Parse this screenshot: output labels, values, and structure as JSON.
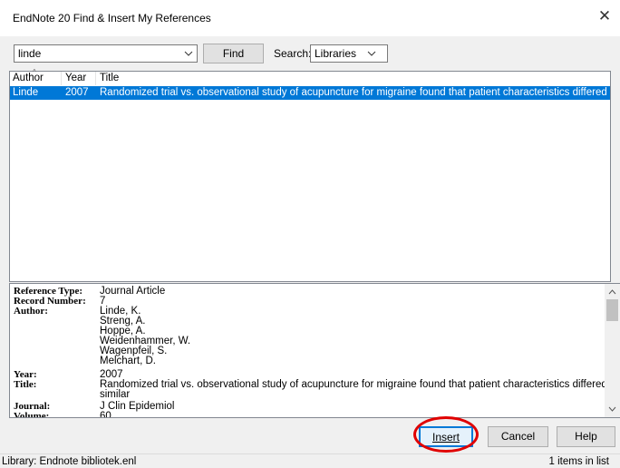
{
  "window": {
    "title": "EndNote 20 Find & Insert My References"
  },
  "search": {
    "query": "linde",
    "find_label": "Find",
    "search_label": "Search:",
    "scope": "Libraries"
  },
  "list": {
    "columns": [
      "Author",
      "Year",
      "Title"
    ],
    "rows": [
      {
        "author": "Linde",
        "year": "2007",
        "title": "Randomized trial vs. observational study of acupuncture for migraine found that patient characteristics differed but outcomes ..."
      }
    ]
  },
  "detail": {
    "reference_type_label": "Reference Type:",
    "reference_type": "Journal Article",
    "record_number_label": "Record Number:",
    "record_number": "7",
    "author_label": "Author:",
    "authors": [
      "Linde, K.",
      "Streng, A.",
      "Hoppe, A.",
      "Weidenhammer, W.",
      "Wagenpfeil, S.",
      "Melchart, D."
    ],
    "year_label": "Year:",
    "year": "2007",
    "title_label": "Title:",
    "title_line1": "Randomized trial vs. observational study of acupuncture for migraine found that patient characteristics differed but outcomes were",
    "title_line2": "similar",
    "journal_label": "Journal:",
    "journal": "J Clin Epidemiol",
    "volume_label": "Volume:",
    "volume": "60"
  },
  "buttons": {
    "insert": "Insert",
    "cancel": "Cancel",
    "help": "Help"
  },
  "status": {
    "library": "Library: Endnote bibliotek.enl",
    "count": "1 items in list"
  },
  "colors": {
    "selection": "#0078d7",
    "highlight_circle": "#e00000"
  }
}
